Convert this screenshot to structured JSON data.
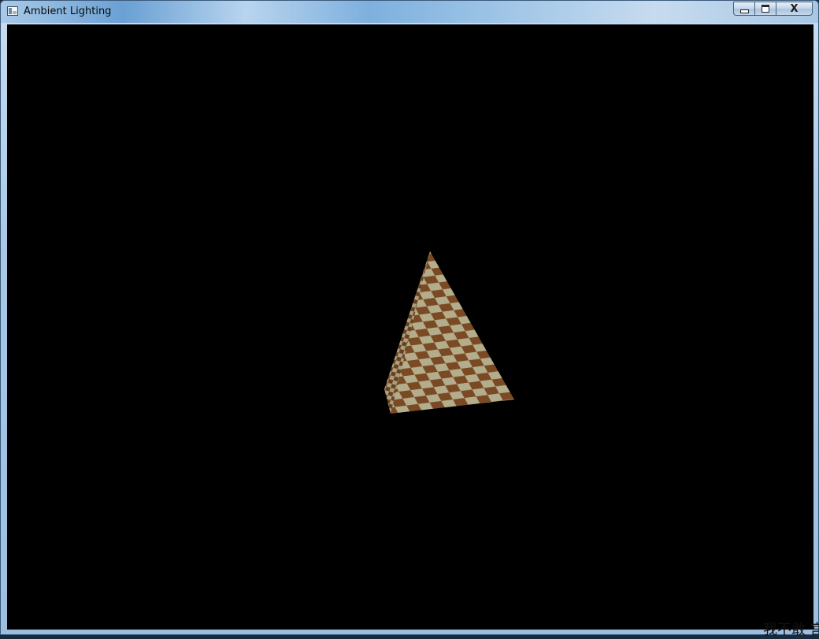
{
  "window": {
    "title": "Ambient Lighting",
    "icon": "app-window-icon",
    "controls": {
      "minimize_icon": "minimize-icon",
      "maximize_icon": "maximize-icon",
      "close_icon": "close-icon",
      "close_glyph": "X"
    }
  },
  "scene": {
    "background": "#000000",
    "object": "checkered-pyramid",
    "colors": {
      "dark_tile": "#7a4a24",
      "light_tile": "#b4ad8c"
    }
  },
  "overlay": {
    "text": "我不敢 宫"
  }
}
